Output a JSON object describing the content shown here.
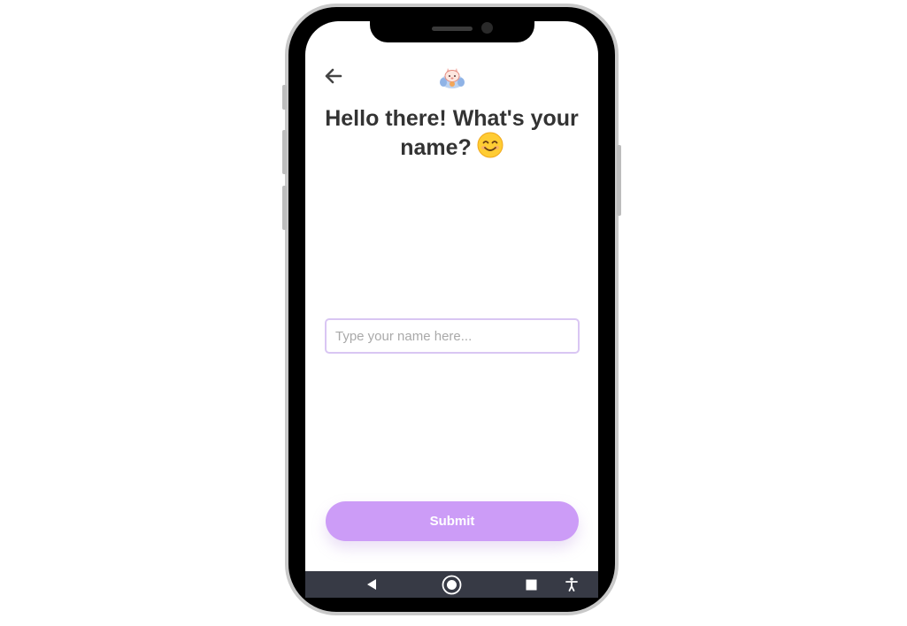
{
  "header": {
    "back_icon": "arrow-left-icon",
    "logo_icon": "cat-mascot-icon"
  },
  "main": {
    "title": "Hello there! What's your name?",
    "title_emoji": "😊",
    "name_input": {
      "value": "",
      "placeholder": "Type your name here..."
    },
    "submit_label": "Submit"
  },
  "nav_bar": {
    "items": [
      "back-triangle-icon",
      "home-circle-icon",
      "recents-square-icon",
      "accessibility-icon"
    ]
  },
  "colors": {
    "accent": "#cc9cf7",
    "input_border": "#d9c6f3",
    "title_text": "#333333",
    "nav_bar": "#373a45"
  }
}
